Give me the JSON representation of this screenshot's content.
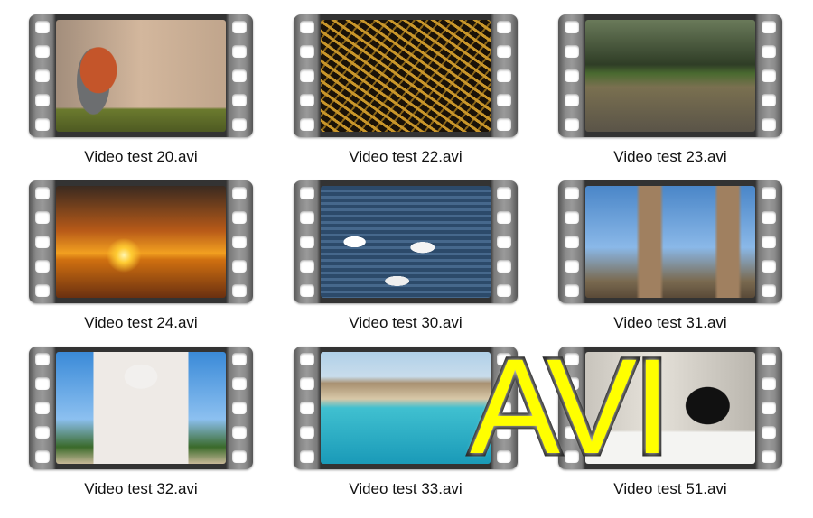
{
  "items": [
    {
      "label": "Video test 20.avi",
      "thumb": "robin-bird-on-moss"
    },
    {
      "label": "Video test 22.avi",
      "thumb": "gold-confetti"
    },
    {
      "label": "Video test 23.avi",
      "thumb": "forest-field"
    },
    {
      "label": "Video test 24.avi",
      "thumb": "sunset-birds-sea"
    },
    {
      "label": "Video test 30.avi",
      "thumb": "swans-on-water"
    },
    {
      "label": "Video test 31.avi",
      "thumb": "tower-bridge"
    },
    {
      "label": "Video test 32.avi",
      "thumb": "taj-mahal"
    },
    {
      "label": "Video test 33.avi",
      "thumb": "turquoise-beach"
    },
    {
      "label": "Video test 51.avi",
      "thumb": "dog-in-kitchen"
    }
  ],
  "overlay": {
    "text": "AVI",
    "color": "#ffff00"
  }
}
